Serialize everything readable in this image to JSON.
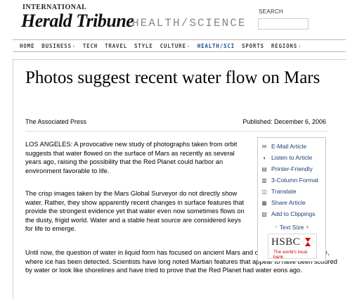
{
  "masthead": {
    "logo_top": "INTERNATIONAL",
    "logo_main": "Herald Tribune",
    "section": "HEALTH/SCIENCE",
    "search_label": "SEARCH",
    "search_value": ""
  },
  "nav": {
    "items": [
      {
        "label": "HOME",
        "arrow": false,
        "active": false
      },
      {
        "label": "BUSINESS",
        "arrow": true,
        "active": false
      },
      {
        "label": "TECH",
        "arrow": false,
        "active": false
      },
      {
        "label": "TRAVEL",
        "arrow": false,
        "active": false
      },
      {
        "label": "STYLE",
        "arrow": false,
        "active": false
      },
      {
        "label": "CULTURE",
        "arrow": true,
        "active": false
      },
      {
        "label": "HEALTH/SCI",
        "arrow": false,
        "active": true
      },
      {
        "label": "SPORTS",
        "arrow": false,
        "active": false
      },
      {
        "label": "REGIONS",
        "arrow": true,
        "active": false
      }
    ]
  },
  "article": {
    "headline": "Photos suggest recent water flow on Mars",
    "byline": "The Associated Press",
    "published": "Published: December 6, 2006",
    "paragraphs": [
      "LOS ANGELES: A provocative new study of photographs taken from orbit suggests that water flowed on the surface of Mars as recently as several years ago, raising the possibility that the Red Planet could harbor an environment favorable to life.",
      "The crisp images taken by the Mars Global Surveyor do not directly show water. Rather, they show apparently recent changes in surface features that provide the strongest evidence yet that water even now sometimes flows on the dusty, frigid world. Water and a stable heat source are considered keys for life to emerge.",
      "Until now, the question of water in liquid form has focused on ancient Mars and on the Martian north pole, where ice has been detected. Scientists have long noted Martian features that appear to have been scoured by water or look like shorelines and have tried to prove that the Red Planet had water eons ago."
    ]
  },
  "tools": {
    "items": [
      {
        "label": "E-Mail Article",
        "icon": "envelope-icon"
      },
      {
        "label": "Listen to Article",
        "icon": "speaker-icon"
      },
      {
        "label": "Printer-Friendly",
        "icon": "printer-icon"
      },
      {
        "label": "3-Column Format",
        "icon": "columns-icon"
      },
      {
        "label": "Translate",
        "icon": "translate-icon"
      },
      {
        "label": "Share Article",
        "icon": "share-icon"
      },
      {
        "label": "Add to Clippings",
        "icon": "clippings-icon"
      }
    ],
    "text_size": "Text Size",
    "text_size_minus": "−",
    "text_size_plus": "+"
  },
  "ad": {
    "brand": "HSBC",
    "tagline": "The world's local bank",
    "logo_color": "#db0011"
  },
  "colors": {
    "link": "#1d3f73",
    "nav_active": "#1d4f8a"
  }
}
